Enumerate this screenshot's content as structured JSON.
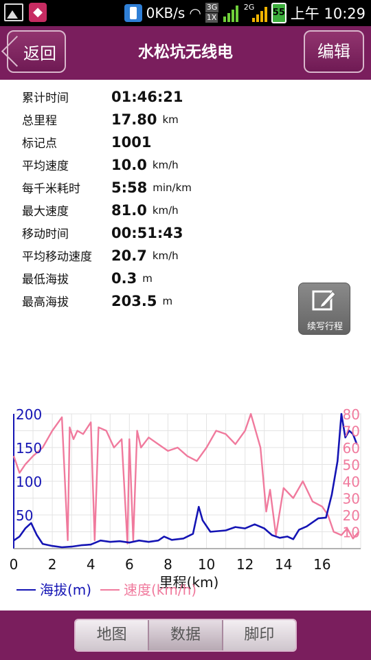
{
  "status_bar": {
    "data_rate": "0KB/s",
    "net1": [
      "3G",
      "1X"
    ],
    "net2": "2G",
    "battery": "55",
    "clock": "上午 10:29"
  },
  "header": {
    "back_label": "返回",
    "title": "水松坑无线电",
    "edit_label": "编辑"
  },
  "stats": [
    {
      "label": "累计时间",
      "value": "01:46:21",
      "unit": ""
    },
    {
      "label": "总里程",
      "value": "17.80",
      "unit": "km"
    },
    {
      "label": "标记点",
      "value": "1001",
      "unit": ""
    },
    {
      "label": "平均速度",
      "value": "10.0",
      "unit": "km/h"
    },
    {
      "label": "每千米耗时",
      "value": "5:58",
      "unit": "min/km"
    },
    {
      "label": "最大速度",
      "value": "81.0",
      "unit": "km/h"
    },
    {
      "label": "移动时间",
      "value": "00:51:43",
      "unit": ""
    },
    {
      "label": "平均移动速度",
      "value": "20.7",
      "unit": "km/h"
    },
    {
      "label": "最低海拔",
      "value": "0.3",
      "unit": "m"
    },
    {
      "label": "最高海拔",
      "value": "203.5",
      "unit": "m"
    }
  ],
  "resume_button_label": "续写行程",
  "chart_data": {
    "type": "line",
    "xlabel": "里程(km)",
    "xlim": [
      0,
      18
    ],
    "x_ticks": [
      0,
      2,
      4,
      6,
      8,
      10,
      12,
      14,
      16
    ],
    "left_axis": {
      "ylim": [
        0,
        200
      ],
      "ticks": [
        50,
        100,
        150,
        200
      ]
    },
    "right_axis": {
      "ylim": [
        0,
        80
      ],
      "ticks": [
        10,
        20,
        30,
        40,
        50,
        60,
        70,
        80
      ]
    },
    "grid": true,
    "legend_position": "bottom-left",
    "series": [
      {
        "name": "海拔(m)",
        "axis": "left",
        "color": "#1414b4",
        "x": [
          0,
          0.3,
          0.6,
          0.9,
          1.2,
          1.5,
          2,
          2.5,
          3,
          3.5,
          4,
          4.5,
          5,
          5.5,
          6,
          6.5,
          7,
          7.5,
          7.8,
          8.2,
          8.8,
          9.3,
          9.6,
          9.8,
          10.2,
          11,
          11.5,
          12,
          12.5,
          13,
          13.4,
          13.8,
          14.2,
          14.5,
          14.8,
          15.2,
          15.8,
          16.2,
          16.5,
          16.8,
          17,
          17.2,
          17.4,
          17.6,
          17.8
        ],
        "y": [
          12,
          18,
          30,
          38,
          20,
          7,
          4,
          2,
          3,
          5,
          6,
          12,
          10,
          11,
          9,
          12,
          10,
          12,
          18,
          13,
          15,
          22,
          62,
          42,
          25,
          27,
          32,
          30,
          36,
          30,
          20,
          16,
          18,
          14,
          28,
          33,
          45,
          46,
          80,
          130,
          200,
          165,
          175,
          170,
          155
        ]
      },
      {
        "name": "速度(km/h)",
        "axis": "right",
        "color": "#f07a9d",
        "x": [
          0,
          0.3,
          0.6,
          1,
          1.5,
          2,
          2.5,
          2.8,
          2.9,
          3.1,
          3.3,
          3.6,
          4,
          4.2,
          4.4,
          4.8,
          5.2,
          5.6,
          5.9,
          6.0,
          6.2,
          6.4,
          6.6,
          7,
          7.5,
          8,
          8.5,
          9,
          9.5,
          10,
          10.5,
          11,
          11.5,
          12,
          12.3,
          12.8,
          13.1,
          13.3,
          13.6,
          14,
          14.5,
          15,
          15.5,
          16,
          16.3,
          16.6,
          17,
          17.3,
          17.6,
          17.9
        ],
        "y": [
          55,
          45,
          50,
          55,
          60,
          70,
          78,
          5,
          72,
          65,
          70,
          68,
          75,
          5,
          72,
          70,
          60,
          65,
          3,
          65,
          5,
          70,
          60,
          66,
          62,
          58,
          60,
          55,
          52,
          60,
          70,
          68,
          62,
          70,
          80,
          60,
          22,
          35,
          8,
          36,
          30,
          40,
          28,
          25,
          20,
          10,
          8,
          12,
          6,
          10
        ]
      }
    ]
  },
  "tabs": [
    {
      "label": "地图",
      "active": false
    },
    {
      "label": "数据",
      "active": true
    },
    {
      "label": "脚印",
      "active": false
    }
  ]
}
